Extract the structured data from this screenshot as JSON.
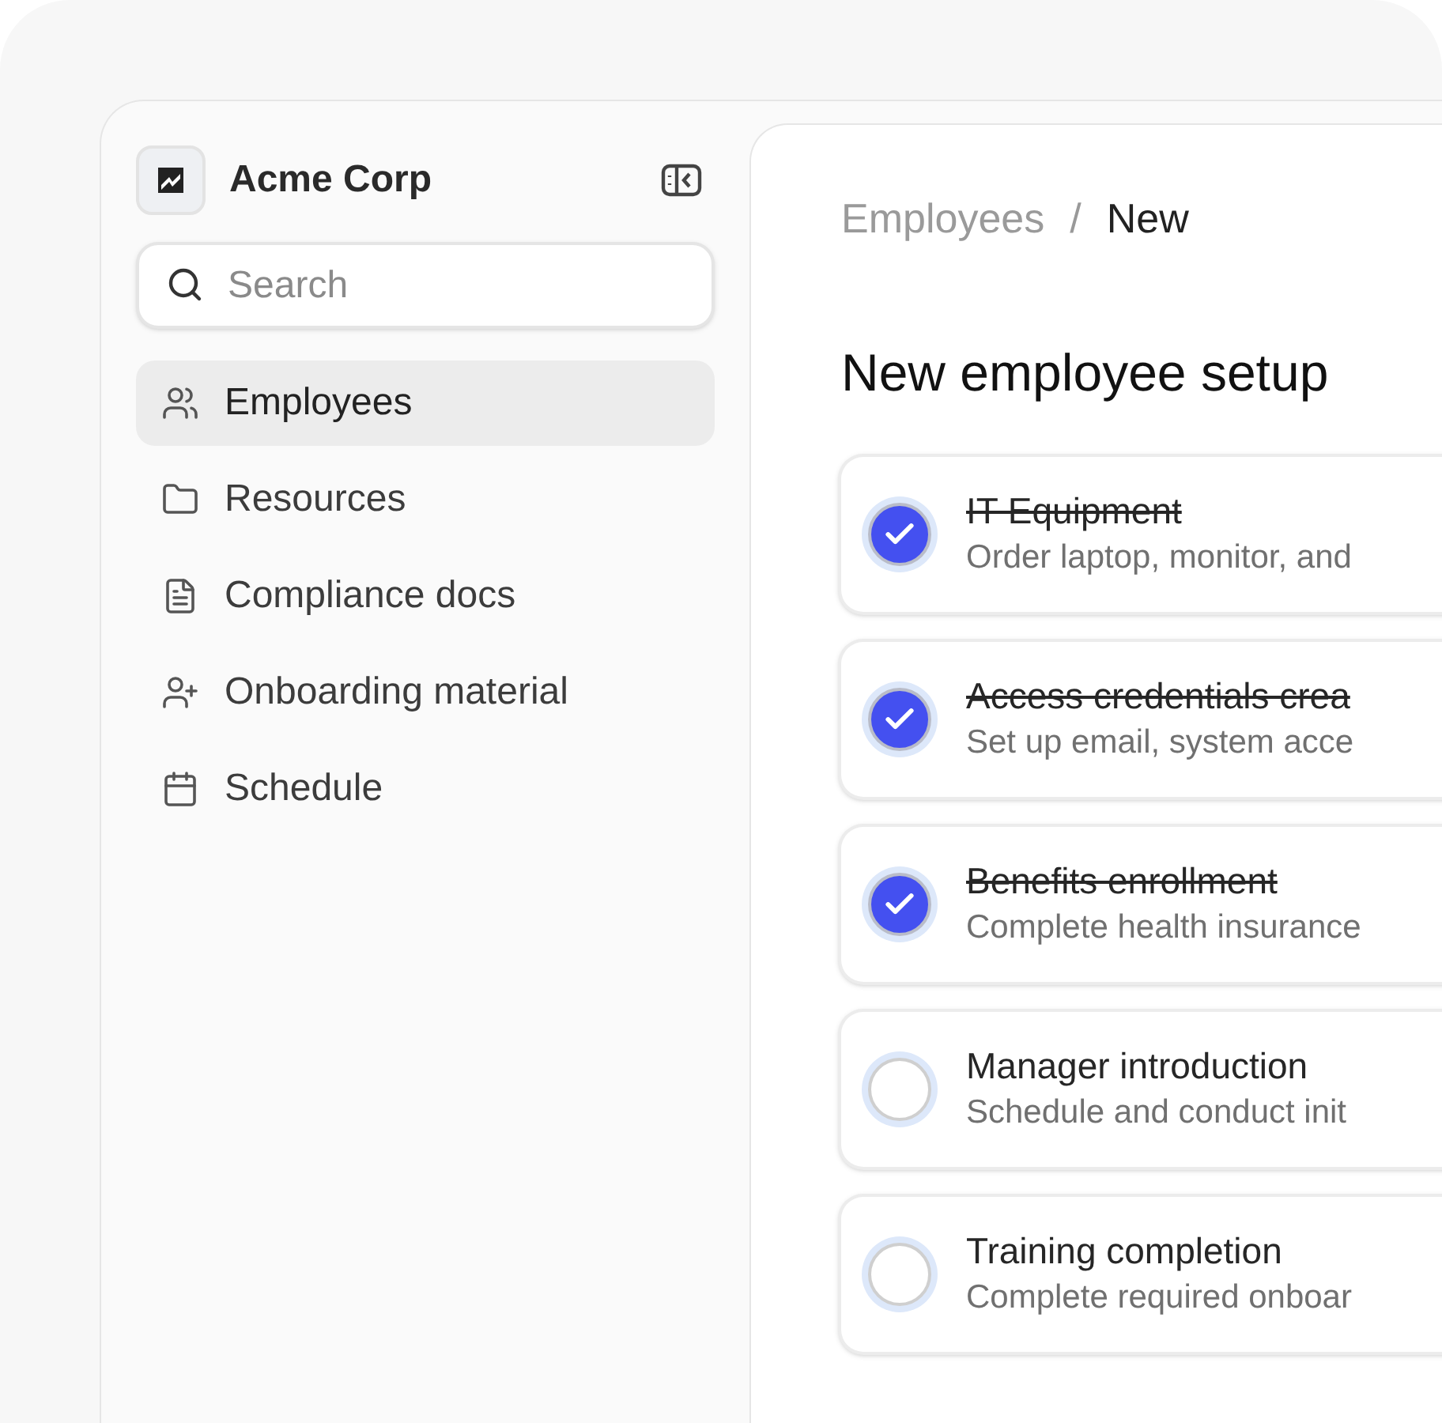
{
  "sidebar": {
    "org_name": "Acme Corp",
    "search": {
      "placeholder": "Search"
    },
    "items": [
      {
        "label": "Employees",
        "selected": true
      },
      {
        "label": "Resources",
        "selected": false
      },
      {
        "label": "Compliance docs",
        "selected": false
      },
      {
        "label": "Onboarding material",
        "selected": false
      },
      {
        "label": "Schedule",
        "selected": false
      }
    ]
  },
  "breadcrumb": [
    {
      "label": "Employees",
      "current": false
    },
    {
      "label": "New",
      "current": true
    }
  ],
  "breadcrumb_separator": "/",
  "title": "New employee setup",
  "tasks": [
    {
      "title": "IT Equipment",
      "description": "Order laptop, monitor, and",
      "checked": true
    },
    {
      "title": "Access credentials crea",
      "description": "Set up email, system acce",
      "checked": true
    },
    {
      "title": "Benefits enrollment",
      "description": "Complete health insurance",
      "checked": true
    },
    {
      "title": "Manager introduction",
      "description": "Schedule and conduct init",
      "checked": false
    },
    {
      "title": "Training completion",
      "description": "Complete required onboar",
      "checked": false
    }
  ]
}
